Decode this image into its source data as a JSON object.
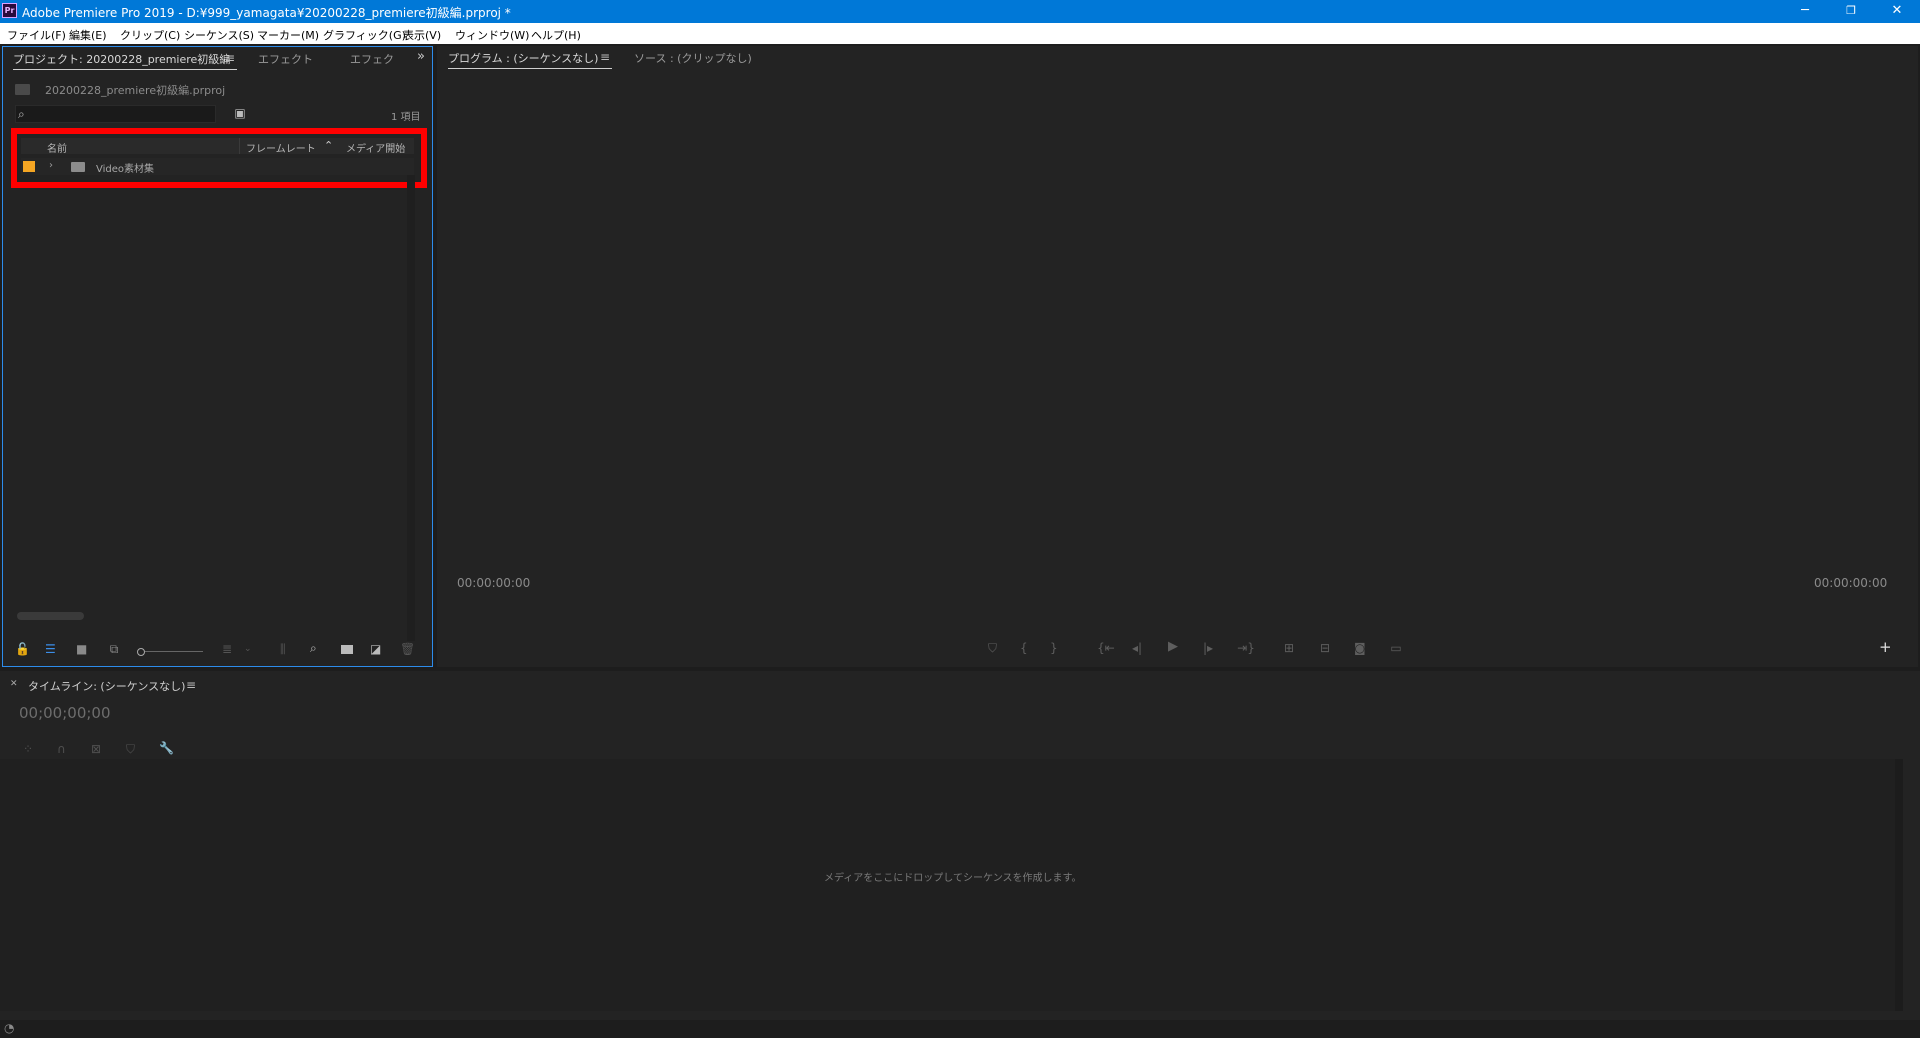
{
  "window": {
    "title": "Adobe Premiere Pro 2019 - D:¥999_yamagata¥20200228_premiere初級編.prproj *",
    "app_icon": "Pr"
  },
  "menu": [
    "ファイル(F)",
    "編集(E)",
    "クリップ(C)",
    "シーケンス(S)",
    "マーカー(M)",
    "グラフィック(G)",
    "表示(V)",
    "ウィンドウ(W)",
    "ヘルプ(H)"
  ],
  "project_panel": {
    "tab_project": "プロジェクト: 20200228_premiere初級編",
    "tab_effects": "エフェクト",
    "tab_effects2": "エフェク",
    "project_file": "20200228_premiere初級編.prproj",
    "item_count": "1 項目",
    "columns": [
      "名前",
      "フレームレート",
      "メディア開始"
    ],
    "rows": [
      {
        "name": "Video素材集",
        "label_color": "#f5a623"
      }
    ]
  },
  "program_panel": {
    "tab_program": "プログラム : (シーケンスなし)",
    "tab_source": "ソース : (クリップなし)",
    "timecode_left": "00:00:00:00",
    "timecode_right": "00:00:00:00"
  },
  "timeline_panel": {
    "tab": "タイムライン: (シーケンスなし)",
    "timecode": "00;00;00;00",
    "drop_hint": "メディアをここにドロップしてシーケンスを作成します。"
  },
  "colors": {
    "titlebar": "#0078d7",
    "panel_bg": "#232323",
    "focus_border": "#2d8ceb",
    "annotation": "#ff0000"
  }
}
